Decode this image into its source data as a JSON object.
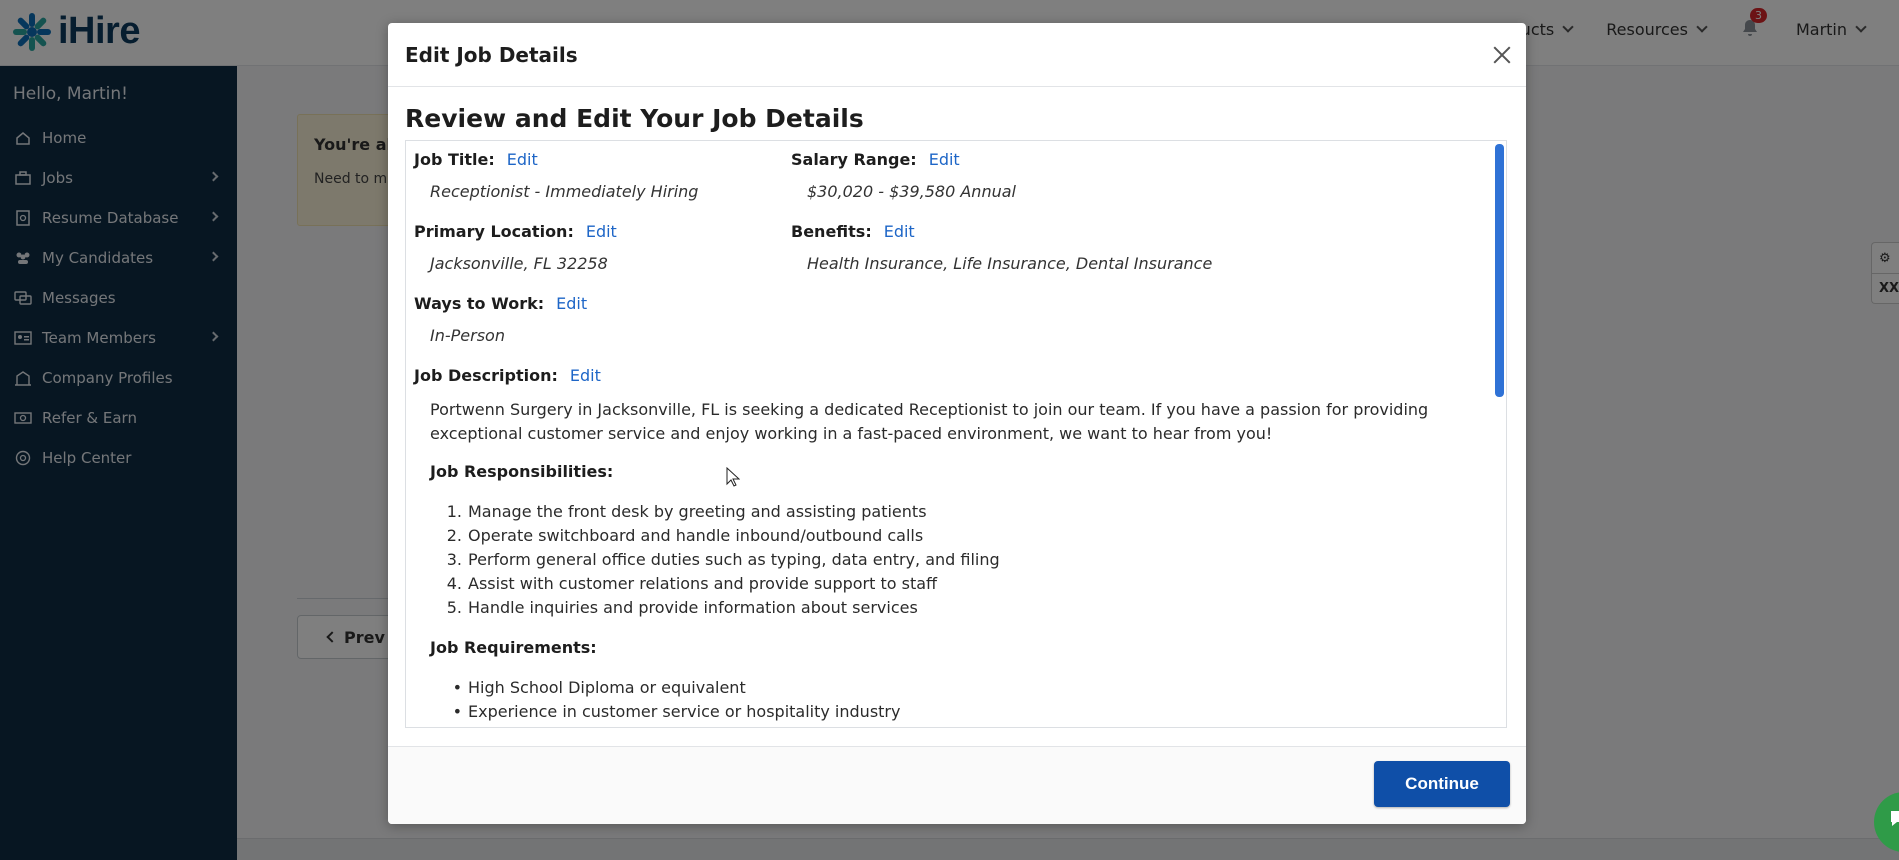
{
  "header": {
    "logo_text": "iHire",
    "nav": [
      {
        "label": "Products"
      },
      {
        "label": "Resources"
      }
    ],
    "notification_count": "3",
    "user_name": "Martin"
  },
  "sidebar": {
    "greeting": "Hello, Martin!",
    "items": [
      {
        "label": "Home",
        "icon": "home-icon"
      },
      {
        "label": "Jobs",
        "icon": "briefcase-icon"
      },
      {
        "label": "Resume Database",
        "icon": "document-search-icon"
      },
      {
        "label": "My Candidates",
        "icon": "people-icon"
      },
      {
        "label": "Messages",
        "icon": "messages-icon"
      },
      {
        "label": "Team Members",
        "icon": "id-card-icon"
      },
      {
        "label": "Company Profiles",
        "icon": "building-icon"
      },
      {
        "label": "Refer & Earn",
        "icon": "money-icon"
      },
      {
        "label": "Help Center",
        "icon": "help-icon"
      }
    ]
  },
  "background": {
    "alert_title": "You're al",
    "alert_text": "Need to ma",
    "prev_label": "Prev",
    "right_tab_bottom": "XX"
  },
  "modal": {
    "title": "Edit Job Details",
    "heading": "Review and Edit Your Job Details",
    "edit_label": "Edit",
    "fields": {
      "job_title": {
        "label": "Job Title:",
        "value": "Receptionist - Immediately Hiring"
      },
      "salary_range": {
        "label": "Salary Range:",
        "value": "$30,020 - $39,580 Annual"
      },
      "primary_location": {
        "label": "Primary Location:",
        "value": "Jacksonville, FL 32258"
      },
      "benefits": {
        "label": "Benefits:",
        "value": "Health Insurance, Life Insurance, Dental Insurance"
      },
      "ways_to_work": {
        "label": "Ways to Work:",
        "value": "In-Person"
      },
      "job_description": {
        "label": "Job Description:"
      }
    },
    "description": "Portwenn Surgery in Jacksonville, FL is seeking a dedicated Receptionist to join our team. If you have a passion for providing exceptional customer service and enjoy working in a fast-paced environment, we want to hear from you!",
    "responsibilities_heading": "Job Responsibilities:",
    "responsibilities": [
      "Manage the front desk by greeting and assisting patients",
      "Operate switchboard and handle inbound/outbound calls",
      "Perform general office duties such as typing, data entry, and filing",
      "Assist with customer relations and provide support to staff",
      "Handle inquiries and provide information about services"
    ],
    "requirements_heading": "Job Requirements:",
    "requirements": [
      "High School Diploma or equivalent",
      "Experience in customer service or hospitality industry"
    ],
    "continue_label": "Continue"
  },
  "colors": {
    "sidebar_bg": "#0f2d45",
    "link_blue": "#1e66c7",
    "primary_button": "#0f4fa8",
    "badge_red": "#d9262b"
  }
}
